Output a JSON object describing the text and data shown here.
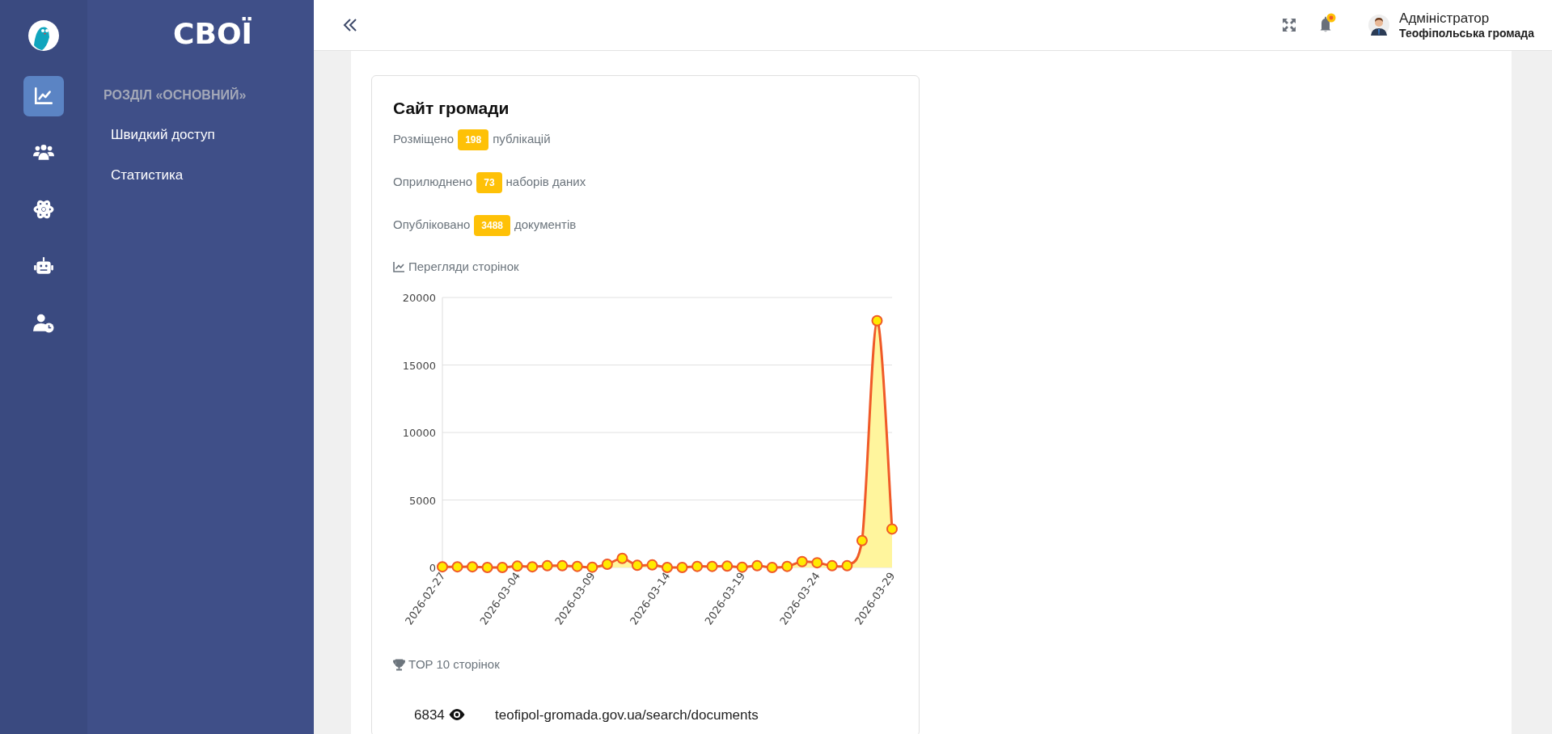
{
  "rail": {
    "items": [
      {
        "kind": "chart",
        "selected": true
      },
      {
        "kind": "users",
        "selected": false
      },
      {
        "kind": "atom",
        "selected": false
      },
      {
        "kind": "robot",
        "selected": false
      },
      {
        "kind": "user-clock",
        "selected": false
      }
    ]
  },
  "sidebar": {
    "brand": "СВОЇ",
    "section": "РОЗДІЛ «ОСНОВНИЙ»",
    "items": [
      {
        "label": "Швидкий доступ"
      },
      {
        "label": "Статистика"
      }
    ]
  },
  "header": {
    "user_name": "Адміністратор",
    "user_org": "Теофіпольська громада"
  },
  "card": {
    "title": "Сайт громади",
    "stats": [
      {
        "before": "Розміщено",
        "count": "198",
        "after": "публікацій"
      },
      {
        "before": "Оприлюднено",
        "count": "73",
        "after": "наборів даних"
      },
      {
        "before": "Опубліковано",
        "count": "3488",
        "after": "документів"
      }
    ],
    "chart_heading": "Перегляди сторінок",
    "chart_data": {
      "type": "area",
      "categories": [
        "2026-02-27",
        null,
        null,
        null,
        null,
        "2026-03-04",
        null,
        null,
        null,
        null,
        "2026-03-09",
        null,
        null,
        null,
        null,
        "2026-03-14",
        null,
        null,
        null,
        null,
        "2026-03-19",
        null,
        null,
        null,
        null,
        "2026-03-24",
        null,
        null,
        null,
        null,
        "2026-03-29"
      ],
      "grid": true,
      "series": [
        {
          "color": "#f05a28",
          "values": [
            50,
            50,
            50,
            0,
            0,
            100,
            50,
            130,
            130,
            80,
            20,
            240,
            670,
            160,
            190,
            0,
            0,
            80,
            80,
            100,
            20,
            130,
            0,
            80,
            430,
            350,
            130,
            130,
            1990,
            18280,
            2850
          ]
        }
      ],
      "ylim": [
        0,
        20000
      ],
      "yticks": [
        0,
        5000,
        10000,
        15000,
        20000
      ]
    },
    "top_heading": "TOP 10 сторінок",
    "top_pages": [
      {
        "views": "6834",
        "url": "teofipol-gromada.gov.ua/search/documents"
      }
    ]
  }
}
